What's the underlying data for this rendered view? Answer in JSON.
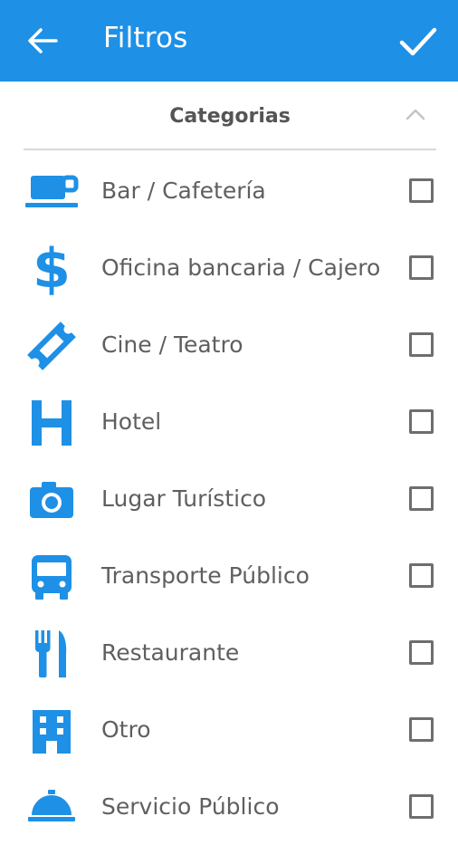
{
  "appbar": {
    "title": "Filtros",
    "back_icon": "arrow-back-icon",
    "confirm_icon": "checkmark-icon",
    "color": "#1e90e6"
  },
  "section": {
    "label": "Categorias",
    "expanded": true,
    "toggle_icon": "chevron-up-icon"
  },
  "accent_color": "#1e90e6",
  "categories": [
    {
      "label": "Bar / Cafetería",
      "icon": "coffee-cup-icon",
      "checked": false
    },
    {
      "label": "Oficina bancaria / Cajero",
      "icon": "dollar-sign-icon",
      "checked": false
    },
    {
      "label": "Cine / Teatro",
      "icon": "ticket-icon",
      "checked": false
    },
    {
      "label": "Hotel",
      "icon": "hotel-h-icon",
      "checked": false
    },
    {
      "label": "Lugar Turístico",
      "icon": "camera-icon",
      "checked": false
    },
    {
      "label": "Transporte Público",
      "icon": "bus-icon",
      "checked": false
    },
    {
      "label": "Restaurante",
      "icon": "fork-knife-icon",
      "checked": false
    },
    {
      "label": "Otro",
      "icon": "building-icon",
      "checked": false
    },
    {
      "label": "Servicio Público",
      "icon": "service-bell-icon",
      "checked": false
    }
  ]
}
